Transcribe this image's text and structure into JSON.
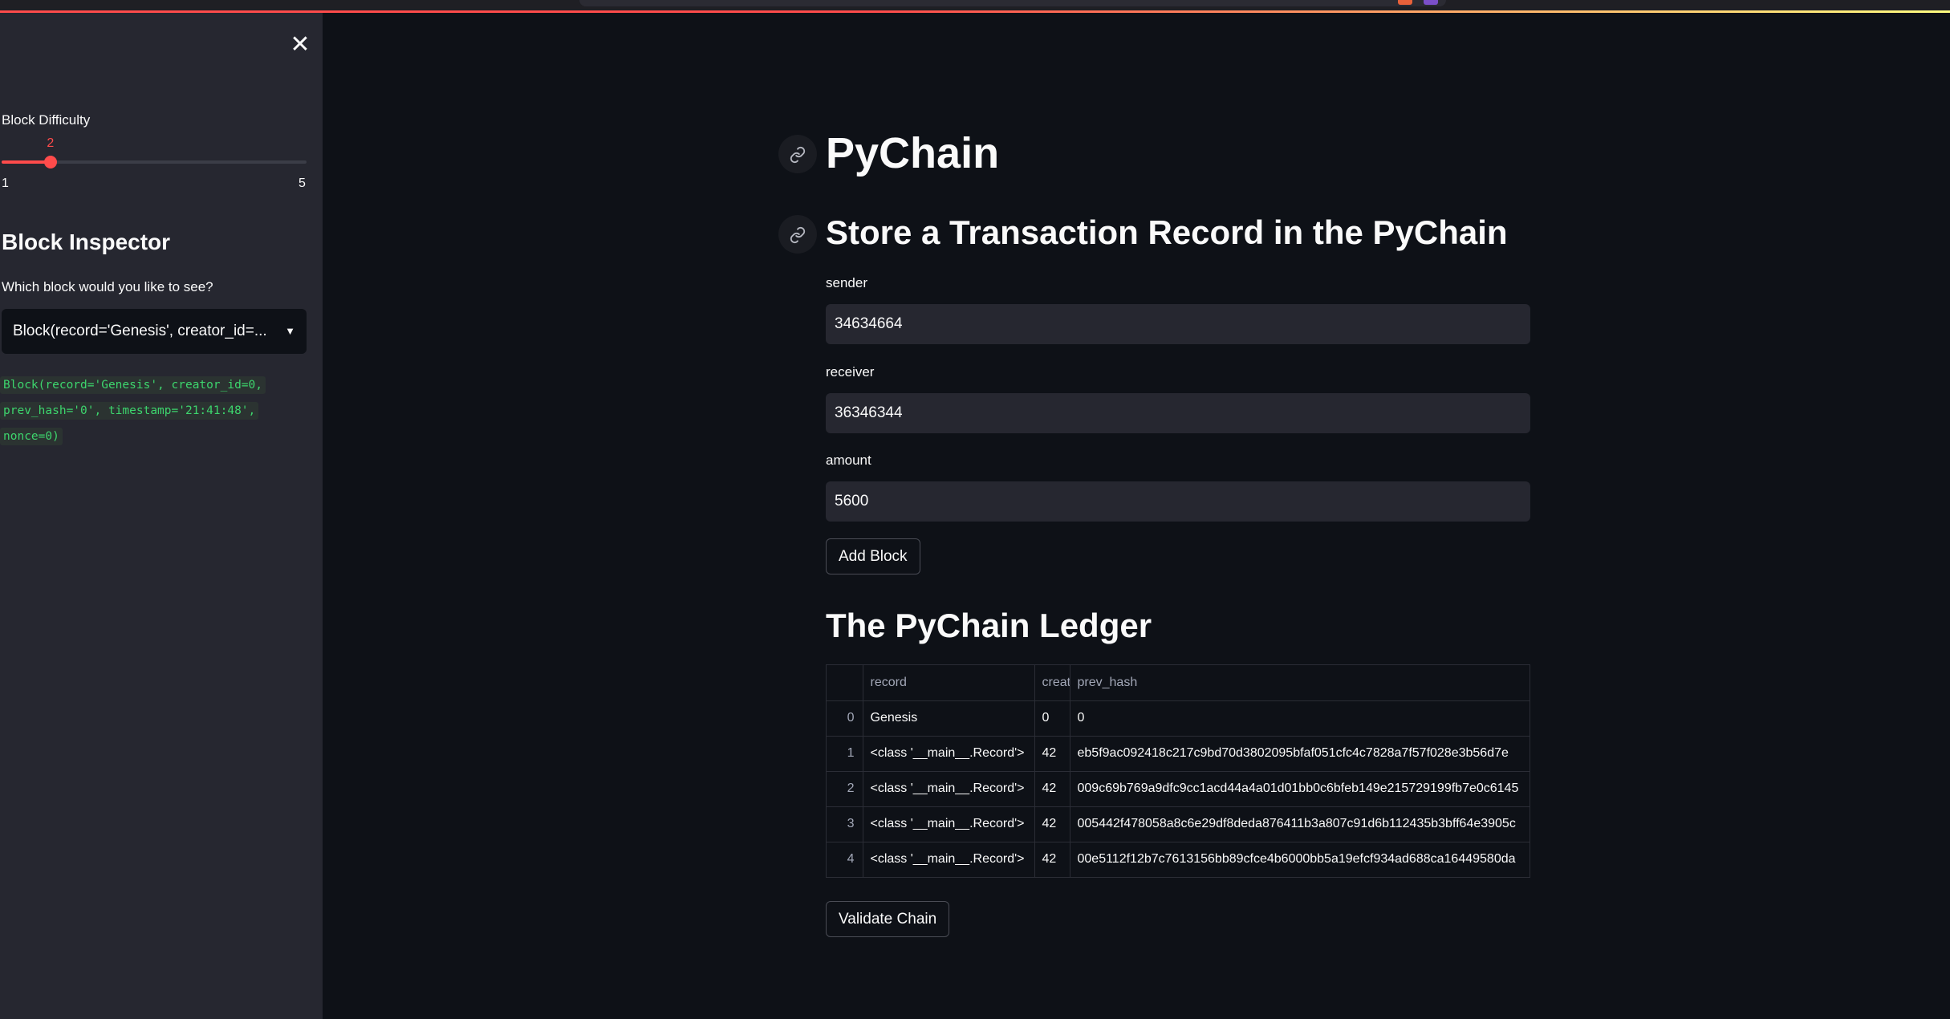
{
  "sidebar": {
    "close_symbol": "✕",
    "difficulty": {
      "label": "Block Difficulty",
      "value": 2,
      "value_text": "2",
      "min": 1,
      "max": 5,
      "min_text": "1",
      "max_text": "5"
    },
    "inspector": {
      "heading": "Block Inspector",
      "question": "Which block would you like to see?",
      "selected": "Block(record='Genesis', creator_id=...",
      "code_lines": [
        "Block(record='Genesis', creator_id=0,",
        "prev_hash='0', timestamp='21:41:48',",
        "nonce=0)"
      ]
    }
  },
  "main": {
    "title": "PyChain",
    "form_heading": "Store a Transaction Record in the PyChain",
    "fields": {
      "sender": {
        "label": "sender",
        "value": "34634664"
      },
      "receiver": {
        "label": "receiver",
        "value": "36346344"
      },
      "amount": {
        "label": "amount",
        "value": "5600"
      }
    },
    "add_block_label": "Add Block",
    "ledger_heading": "The PyChain Ledger",
    "ledger": {
      "columns": [
        "",
        "record",
        "creat",
        "prev_hash"
      ],
      "rows": [
        {
          "index": "0",
          "record": "Genesis",
          "creator": "0",
          "prev_hash": "0"
        },
        {
          "index": "1",
          "record": "<class '__main__.Record'>",
          "creator": "42",
          "prev_hash": "eb5f9ac092418c217c9bd70d3802095bfaf051cfc4c7828a7f57f028e3b56d7e"
        },
        {
          "index": "2",
          "record": "<class '__main__.Record'>",
          "creator": "42",
          "prev_hash": "009c69b769a9dfc9cc1acd44a4a01d01bb0c6bfeb149e215729199fb7e0c6145"
        },
        {
          "index": "3",
          "record": "<class '__main__.Record'>",
          "creator": "42",
          "prev_hash": "005442f478058a8c6e29df8deda876411b3a807c91d6b112435b3bff64e3905c"
        },
        {
          "index": "4",
          "record": "<class '__main__.Record'>",
          "creator": "42",
          "prev_hash": "00e5112f12b7c7613156bb89cfce4b6000bb5a19efcf934ad688ca16449580da"
        }
      ]
    },
    "validate_label": "Validate Chain"
  },
  "icons": {
    "link": "link-icon",
    "close": "close-icon",
    "caret": "chevron-down-icon"
  },
  "colors": {
    "accent": "#ff4b4b",
    "background": "#0e1117",
    "sidebar": "#262730",
    "code_text": "#3dd56d"
  }
}
